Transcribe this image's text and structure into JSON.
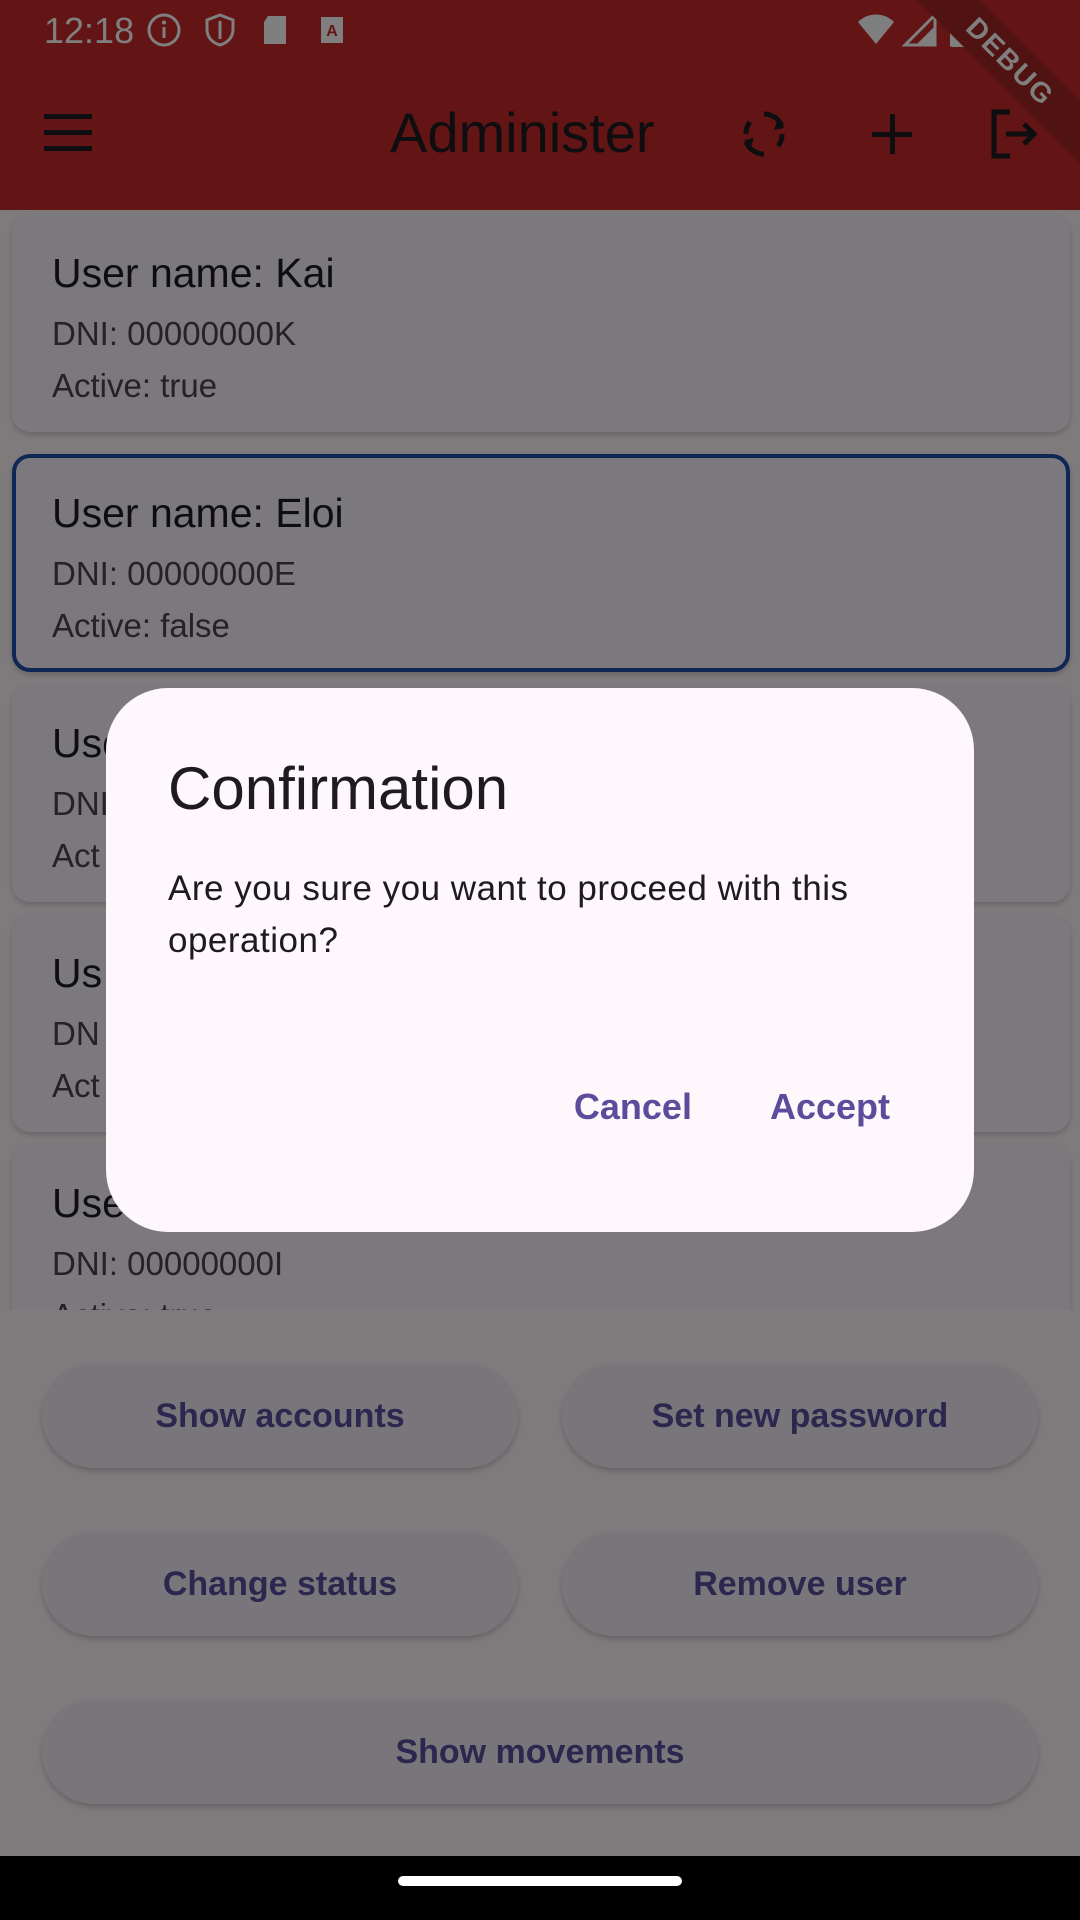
{
  "status_bar": {
    "time": "12:18",
    "left_icons": [
      "info-icon",
      "shield-icon",
      "sd-card-icon",
      "font-icon"
    ],
    "right_icons": [
      "wifi-icon",
      "signal-icon",
      "battery-icon"
    ]
  },
  "app_bar": {
    "title": "Administer",
    "color": "#c62828",
    "actions": [
      "refresh-icon",
      "add-icon",
      "logout-icon"
    ],
    "debug_label": "DEBUG"
  },
  "users": [
    {
      "title": "User name: Kai",
      "dni": "DNI: 00000000K",
      "active": "Active: true",
      "selected": false
    },
    {
      "title": "User name: Eloi",
      "dni": "DNI: 00000000E",
      "active": "Active: false",
      "selected": true
    },
    {
      "title": "Use",
      "dni": "DNI",
      "active": "Act",
      "selected": false
    },
    {
      "title": "Us",
      "dni": "DN",
      "active": "Act",
      "selected": false
    },
    {
      "title": "Use",
      "dni": "DNI: 00000000I",
      "active": "Active: true",
      "selected": false
    }
  ],
  "actions": {
    "show_accounts": "Show accounts",
    "set_new_password": "Set new password",
    "change_status": "Change status",
    "remove_user": "Remove user",
    "show_movements": "Show movements"
  },
  "dialog": {
    "title": "Confirmation",
    "message": "Are you sure you want to proceed with this operation?",
    "cancel": "Cancel",
    "accept": "Accept"
  }
}
